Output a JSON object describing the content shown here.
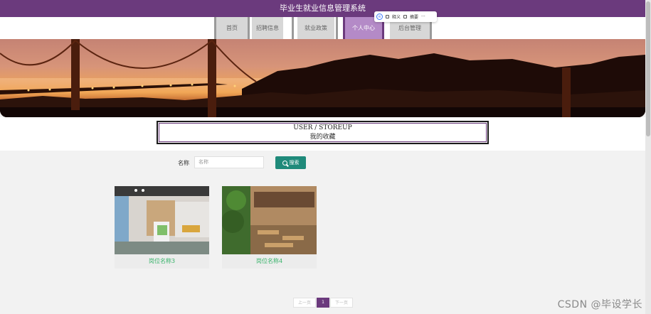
{
  "app_title": "毕业生就业信息管理系统",
  "nav": {
    "items": [
      {
        "label": "首页"
      },
      {
        "label": "招聘信息"
      },
      {
        "label": "就业政策"
      },
      {
        "label": "个人中心"
      },
      {
        "label": "后台管理"
      }
    ],
    "active_index": 3
  },
  "toolbar": {
    "ai_label": "AI",
    "translate_label": "释义",
    "summary_label": "摘要",
    "more_label": "···"
  },
  "section": {
    "title_en": "USER / STOREUP",
    "title_cn": "我的收藏"
  },
  "search": {
    "label": "名称",
    "placeholder": "名称",
    "button_label": "搜索"
  },
  "cards": [
    {
      "name": "岗位名称3"
    },
    {
      "name": "岗位名称4"
    }
  ],
  "pagination": {
    "prev_label": "上一页",
    "current": "1",
    "next_label": "下一页"
  },
  "watermark": "CSDN @毕设学长",
  "colors": {
    "brand": "#6b3a7d",
    "accent_button": "#1f8a7a",
    "card_title": "#39b36b"
  }
}
